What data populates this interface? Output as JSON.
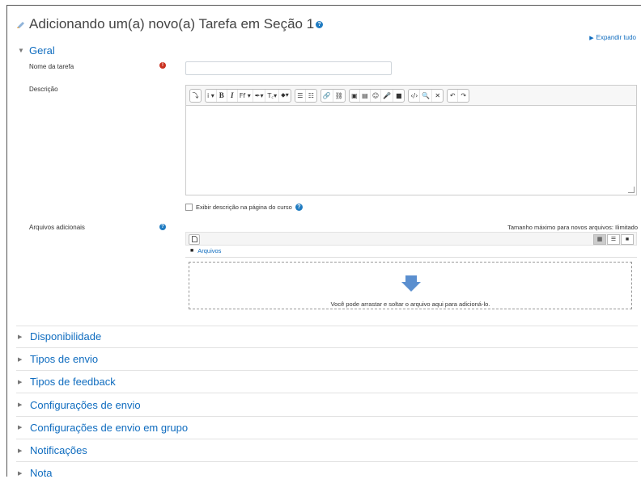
{
  "page": {
    "title": "Adicionando um(a) novo(a) Tarefa em Seção 1",
    "expand_all": "Expandir tudo"
  },
  "general": {
    "header": "Geral",
    "name_label": "Nome da tarefa",
    "name_value": "",
    "description_label": "Descrição",
    "show_description_label": "Exibir descrição na página do curso",
    "files_label": "Arquivos adicionais",
    "max_size_text": "Tamanho máximo para novos arquivos: Ilimitado",
    "files_path": "Arquivos",
    "drop_text": "Você pode arrastar e soltar o arquivo aqui para adicioná-lo."
  },
  "editor_toolbar": {
    "groups": [
      [
        "⤵"
      ],
      [
        "i ▾",
        "B",
        "I",
        "Ff ▾",
        "✒▾",
        "T꜀▾",
        "⬥▾"
      ],
      [
        "☰",
        "☷"
      ],
      [
        "🔗",
        "⛓"
      ],
      [
        "▣",
        "▤",
        "☺",
        "🎤",
        "■"
      ],
      [
        "‹/›",
        "🔍",
        "✕"
      ],
      [
        "↶",
        "↷"
      ]
    ]
  },
  "sections": [
    {
      "label": "Disponibilidade"
    },
    {
      "label": "Tipos de envio"
    },
    {
      "label": "Tipos de feedback"
    },
    {
      "label": "Configurações de envio"
    },
    {
      "label": "Configurações de envio em grupo"
    },
    {
      "label": "Notificações"
    },
    {
      "label": "Nota"
    }
  ],
  "icons": {
    "title": "assign-icon",
    "help": "question-circle-icon",
    "required": "exclamation-circle-icon",
    "expanded": "caret-down-icon",
    "collapsed": "caret-right-icon"
  },
  "colors": {
    "link": "#0f6cbf",
    "required": "#ca3120",
    "help": "#1f7bc1",
    "drop_arrow": "#5b8fcf"
  }
}
